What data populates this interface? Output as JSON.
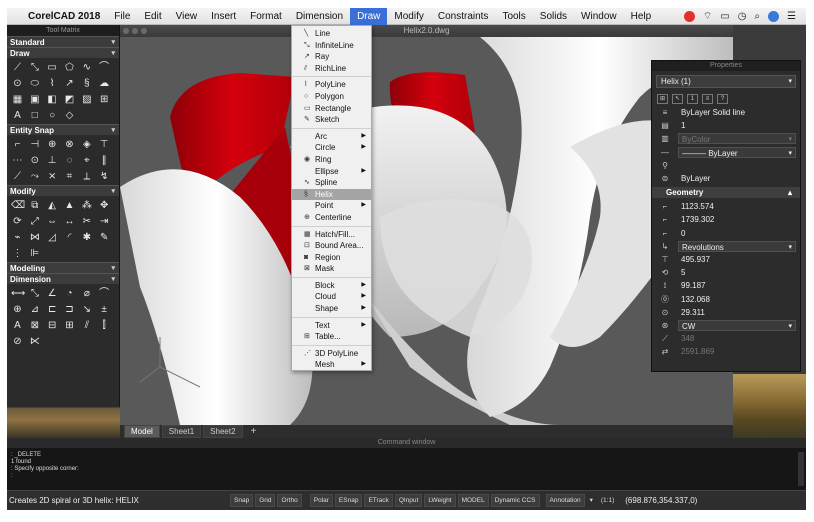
{
  "menubar": {
    "apple": "",
    "app_name": "CorelCAD 2018",
    "items": [
      "File",
      "Edit",
      "View",
      "Insert",
      "Format",
      "Dimension",
      "Draw",
      "Modify",
      "Constraints",
      "Tools",
      "Solids",
      "Window",
      "Help"
    ],
    "active": "Draw"
  },
  "left_panel": {
    "title": "Tool Matrix",
    "sections": [
      "Standard",
      "Draw",
      "Entity Snap",
      "Modify",
      "Modeling",
      "Dimension"
    ],
    "footer": "◂◂◂◂◂"
  },
  "document": {
    "title": "Helix2.0.dwg",
    "tabs": [
      "Model",
      "Sheet1",
      "Sheet2",
      "+"
    ]
  },
  "draw_menu": {
    "items": [
      {
        "label": "Line",
        "icon": "line-icon"
      },
      {
        "label": "InfiniteLine",
        "icon": "infiniteline-icon"
      },
      {
        "label": "Ray",
        "icon": "ray-icon"
      },
      {
        "label": "RichLine",
        "icon": "richline-icon"
      },
      {
        "label": "PolyLine",
        "icon": "polyline-icon"
      },
      {
        "label": "Polygon",
        "icon": "polygon-icon"
      },
      {
        "label": "Rectangle",
        "icon": "rectangle-icon"
      },
      {
        "label": "Sketch",
        "icon": "sketch-icon"
      },
      {
        "label": "Arc",
        "submenu": true
      },
      {
        "label": "Circle",
        "submenu": true
      },
      {
        "label": "Ring",
        "icon": "ring-icon"
      },
      {
        "label": "Ellipse",
        "submenu": true
      },
      {
        "label": "Spline",
        "icon": "spline-icon"
      },
      {
        "label": "Helix",
        "icon": "helix-icon",
        "highlighted": true
      },
      {
        "label": "Point",
        "submenu": true
      },
      {
        "label": "Centerline",
        "icon": "centerline-icon"
      },
      {
        "label": "Hatch/Fill...",
        "icon": "hatch-icon"
      },
      {
        "label": "Bound Area...",
        "icon": "bound-area-icon"
      },
      {
        "label": "Region",
        "icon": "region-icon"
      },
      {
        "label": "Mask",
        "icon": "mask-icon"
      },
      {
        "label": "Block",
        "submenu": true
      },
      {
        "label": "Cloud",
        "submenu": true
      },
      {
        "label": "Shape",
        "submenu": true
      },
      {
        "label": "Text",
        "submenu": true
      },
      {
        "label": "Table...",
        "icon": "table-icon"
      },
      {
        "label": "3D PolyLine",
        "icon": "3d-polyline-icon"
      },
      {
        "label": "Mesh",
        "submenu": true
      }
    ]
  },
  "properties": {
    "title": "Properties",
    "selection": "Helix (1)",
    "general_rows": [
      {
        "value": "ByLayer    Solid line",
        "style": "plain"
      },
      {
        "value": "1",
        "style": "plain"
      },
      {
        "value": "ByColor",
        "style": "boxdim"
      },
      {
        "value": "——— ByLayer",
        "style": "box"
      },
      {
        "value": "",
        "style": "plain"
      },
      {
        "value": "ByLayer",
        "style": "plain"
      }
    ],
    "geometry_label": "Geometry",
    "geometry_rows": [
      {
        "value": "1123.574",
        "style": "plain"
      },
      {
        "value": "1739.302",
        "style": "plain"
      },
      {
        "value": "0",
        "style": "plain"
      },
      {
        "value": "Revolutions",
        "style": "box"
      },
      {
        "value": "495.937",
        "style": "plain"
      },
      {
        "value": "5",
        "style": "plain"
      },
      {
        "value": "99.187",
        "style": "plain"
      },
      {
        "value": "132.068",
        "style": "plain"
      },
      {
        "value": "29.311",
        "style": "plain"
      },
      {
        "value": "CW",
        "style": "box"
      },
      {
        "value": "348",
        "style": "dim"
      },
      {
        "value": "2591.869",
        "style": "dim"
      }
    ]
  },
  "command_window": {
    "title": "Command window",
    "lines": [
      ": _DELETE",
      "1 found",
      ": Specify opposite corner:",
      ":"
    ]
  },
  "status_bar": {
    "hint": "Creates 2D spiral or 3D helix:  HELIX",
    "toggles": [
      "Snap",
      "Grid",
      "Ortho",
      "Polar",
      "ESnap",
      "ETrack",
      "QInput",
      "LWeight",
      "MODEL",
      "Dynamic CCS"
    ],
    "annotation": "Annotation",
    "scale": "(1:1)",
    "coords": "(698.876,354.337,0)"
  },
  "colors": {
    "helix_red": "#c8000a",
    "helix_white": "#e8e8e8",
    "menu_highlight": "#a4a4a4",
    "menubar_active": "#3a6fd8"
  }
}
